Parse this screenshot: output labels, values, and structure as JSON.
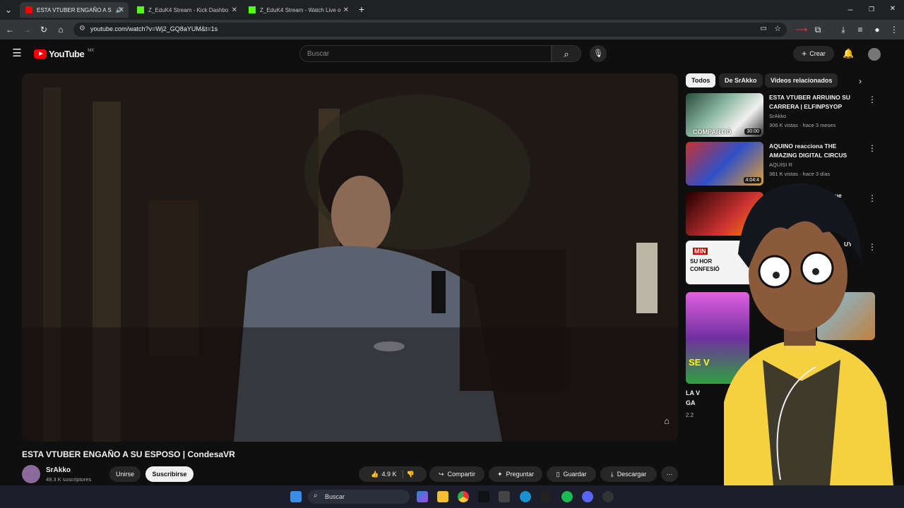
{
  "browser": {
    "tabs": [
      {
        "title": "ESTA VTUBER ENGAÑO A S",
        "active": true
      },
      {
        "title": "Z_EduK4 Stream - Kick Dashbo",
        "active": false
      },
      {
        "title": "Z_EduK4 Stream - Watch Live o",
        "active": false
      }
    ],
    "new_tab": "+",
    "url": "youtube.com/watch?v=Wj2_GQ8aYUM&t=1s"
  },
  "youtube": {
    "logo": "YouTube",
    "region": "MX",
    "search_placeholder": "Buscar",
    "create_label": "Crear",
    "video": {
      "title": "ESTA VTUBER ENGAÑO A SU ESPOSO | CondesaVR",
      "channel": "SrAkko",
      "subscribers": "49.3 K suscriptores",
      "join_label": "Unirse",
      "subscribe_label": "Suscribirse",
      "likes": "4.9 K",
      "share_label": "Compartir",
      "ask_label": "Preguntar",
      "save_label": "Guardar",
      "download_label": "Descargar"
    },
    "chips": [
      "Todos",
      "De SrAkko",
      "Videos relacionados"
    ],
    "recommendations": [
      {
        "title": "ESTA VTUBER ARRUINO SU CARRERA | ELFINPSYOP",
        "channel": "SrAkko",
        "meta": "306 K vistas · hace 3 meses",
        "duration": "30:00",
        "thumb_text": "COMPARTIÓ"
      },
      {
        "title": "AQUINO reacciona THE AMAZING DIGITAL CIRCUS",
        "channel": "AQUISI R",
        "meta": "381 K vistas · hace 3 días",
        "duration": "4:04:4",
        "thumb_text": ""
      }
    ],
    "partial_texts": [
      "r que",
      "UYÓ",
      "MIN",
      "SU HOR",
      "CONFESIÓ",
      "SE V",
      "LA V",
      "GA",
      "2.2"
    ]
  },
  "taskbar": {
    "search_label": "Buscar"
  },
  "colors": {
    "youtube_red": "#ff0000",
    "kick_green": "#53fc18",
    "background": "#0f0f0f"
  }
}
